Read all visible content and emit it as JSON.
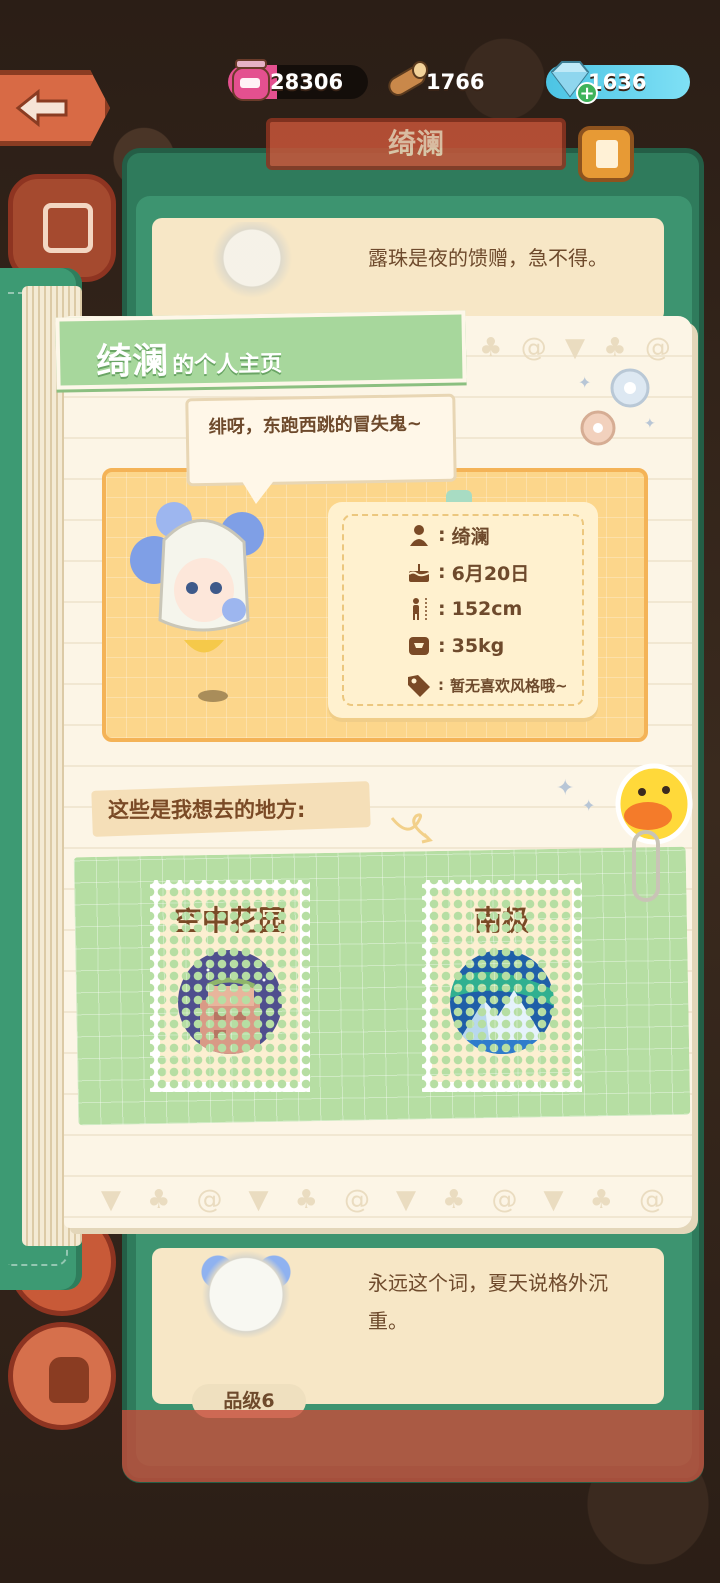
{
  "resources": {
    "jam": "28306",
    "wood": "1766",
    "gem": "1636"
  },
  "background": {
    "panel_title": "绮澜",
    "card1_text": "露珠是夜的馈赠，急不得。",
    "card2_text": "永远这个词，夏天说格外沉重。",
    "grade_label": "品级6"
  },
  "profile": {
    "name": "绮澜",
    "title_suffix": "的个人主页",
    "speech": "绯呀，东跑西跳的冒失鬼~",
    "info": {
      "name": "绮澜",
      "birthday": "6月20日",
      "height": "152cm",
      "weight": "35kg",
      "style": "暂无喜欢风格哦~"
    }
  },
  "wishes": {
    "label": "这些是我想去的地方:",
    "places": [
      {
        "name": "空中花园"
      },
      {
        "name": "南极"
      }
    ]
  },
  "colors": {
    "book_green": "#3d9a73",
    "tag_green": "#a7d79c",
    "card_yellow": "#fcd68b",
    "accent_orange": "#d86a45"
  },
  "icons": {
    "person": "person-icon",
    "birthday": "cake-icon",
    "height": "height-icon",
    "weight": "scale-icon",
    "style": "tag-icon"
  }
}
